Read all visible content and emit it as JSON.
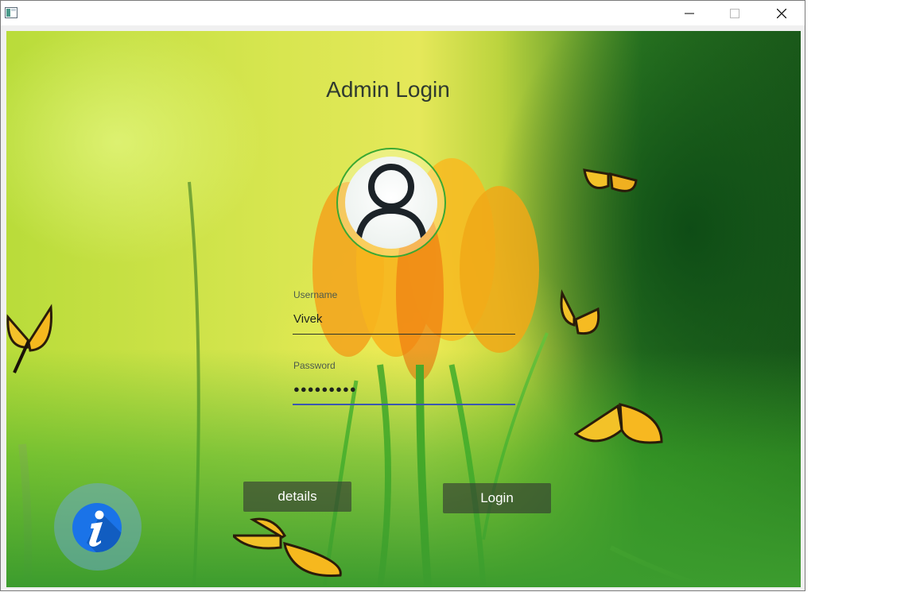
{
  "window": {
    "controls": {
      "minimize": "minimize-icon",
      "maximize": "maximize-icon",
      "close": "close-icon"
    }
  },
  "login": {
    "title": "Admin Login",
    "username": {
      "label": "Username",
      "value": "Vivek"
    },
    "password": {
      "label": "Password",
      "value": "●●●●●●●●●"
    },
    "details_label": "details",
    "login_label": "Login"
  },
  "icons": {
    "avatar": "user-icon",
    "info": "info-icon"
  },
  "colors": {
    "accent_focus": "#3b57b0",
    "avatar_ring": "#3aa832",
    "info_blue": "#1a73e8"
  }
}
